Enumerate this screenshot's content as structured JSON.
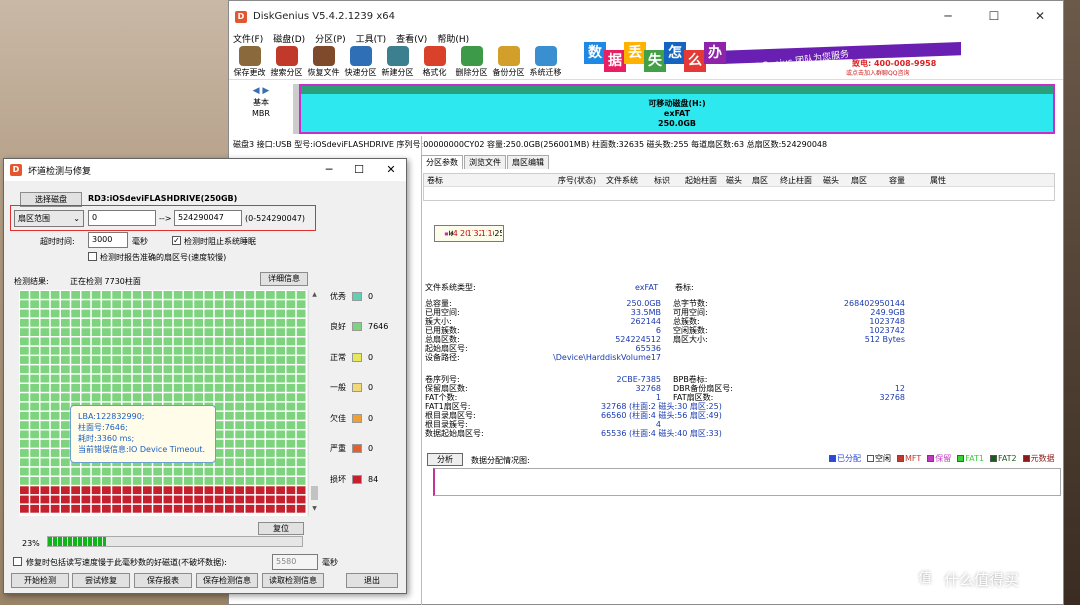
{
  "main": {
    "title": "DiskGenius V5.4.2.1239 x64",
    "logo": "D",
    "menu": [
      "文件(F)",
      "磁盘(D)",
      "分区(P)",
      "工具(T)",
      "查看(V)",
      "帮助(H)"
    ],
    "toolbar": [
      {
        "label": "保存更改",
        "color": "#8a6a3c",
        "icon": "save-changes-icon"
      },
      {
        "label": "搜索分区",
        "color": "#c0392b",
        "icon": "search-partition-icon"
      },
      {
        "label": "恢复文件",
        "color": "#7e4a2b",
        "icon": "recover-file-icon"
      },
      {
        "label": "快速分区",
        "color": "#2e6fb5",
        "icon": "quick-partition-icon"
      },
      {
        "label": "新建分区",
        "color": "#3c7f8e",
        "icon": "new-partition-icon"
      },
      {
        "label": "格式化",
        "color": "#d9412a",
        "icon": "format-icon"
      },
      {
        "label": "删除分区",
        "color": "#3c9a49",
        "icon": "delete-partition-icon"
      },
      {
        "label": "备份分区",
        "color": "#d2a02a",
        "icon": "backup-partition-icon"
      },
      {
        "label": "系统迁移",
        "color": "#3a8fd0",
        "icon": "system-migration-icon"
      }
    ],
    "banner": {
      "chars": [
        {
          "c": "数",
          "color": "#1e88e5"
        },
        {
          "c": "据",
          "color": "#e91e63"
        },
        {
          "c": "丢",
          "color": "#ffb300"
        },
        {
          "c": "失",
          "color": "#43a047"
        },
        {
          "c": "怎",
          "color": "#1565c0"
        },
        {
          "c": "么",
          "color": "#e53935"
        },
        {
          "c": "办",
          "color": "#8e24aa"
        }
      ],
      "slogan": "DiskGenius 团队为您服务",
      "phone": "致电: 400-008-9958",
      "qq": "或点击加入群聊QQ咨询"
    },
    "disk_map": {
      "basic": "基本",
      "mbr": "MBR",
      "partition_name": "可移动磁盘(H:)",
      "fs": "exFAT",
      "size": "250.0GB"
    },
    "disk_info": "磁盘3 接口:USB  型号:iOSdeviFLASHDRIVE  序列号:00000000CY02  容量:250.0GB(256001MB)  柱面数:32635  磁头数:255  每道扇区数:63  总扇区数:524290048",
    "tabs": [
      "分区参数",
      "浏览文件",
      "扇区编辑"
    ],
    "partition_table": {
      "headers": [
        "卷标",
        "序号(状态)",
        "文件系统",
        "标识",
        "起始柱面",
        "磁头",
        "扇区",
        "终止柱面",
        "磁头",
        "扇区",
        "容量",
        "属性"
      ],
      "row": [
        "可移动磁盘(H:)",
        "0",
        "exFAT",
        "07",
        "4",
        "20",
        "17",
        "32635",
        "139",
        "16",
        "250.0GB",
        ""
      ]
    },
    "fs_info": {
      "fs_type_label": "文件系统类型:",
      "fs_type": "exFAT",
      "volume_label_label": "卷标:",
      "left": [
        [
          "总容量:",
          "250.0GB"
        ],
        [
          "已用空间:",
          "33.5MB"
        ],
        [
          "簇大小:",
          "262144"
        ],
        [
          "已用簇数:",
          "6"
        ],
        [
          "总扇区数:",
          "524224512"
        ],
        [
          "起始扇区号:",
          "65536"
        ],
        [
          "设备路径:",
          "\\Device\\HarddiskVolume17"
        ]
      ],
      "right": [
        [
          "总字节数:",
          "268402950144"
        ],
        [
          "可用空间:",
          "249.9GB"
        ],
        [
          "总簇数:",
          "1023748"
        ],
        [
          "空闲簇数:",
          "1023742"
        ],
        [
          "扇区大小:",
          "512 Bytes"
        ]
      ],
      "left2": [
        [
          "卷序列号:",
          "2CBE-7385"
        ],
        [
          "保留扇区数:",
          "32768"
        ],
        [
          "FAT个数:",
          "1"
        ],
        [
          "FAT1扇区号:",
          "32768 (柱面:2 磁头:30 扇区:25)"
        ],
        [
          "根目录扇区号:",
          "66560 (柱面:4 磁头:56 扇区:49)"
        ],
        [
          "根目录簇号:",
          "4"
        ],
        [
          "数据起始扇区号:",
          "65536 (柱面:4 磁头:40 扇区:33)"
        ]
      ],
      "right2": [
        [
          "BPB卷标:",
          ""
        ],
        [
          "DBR备份扇区号:",
          "12"
        ],
        [
          "FAT扇区数:",
          "32768"
        ]
      ]
    },
    "analyze_button": "分析",
    "dist_label": "数据分配情况图:",
    "legend": [
      {
        "label": "已分配",
        "color": "#2b49d8"
      },
      {
        "label": "空闲",
        "color": "#ffffff"
      },
      {
        "label": "MFT",
        "color": "#c0392b"
      },
      {
        "label": "保留",
        "color": "#c03ac0"
      },
      {
        "label": "FAT1",
        "color": "#39d039"
      },
      {
        "label": "FAT2",
        "color": "#1a5a1a"
      },
      {
        "label": "元数据",
        "color": "#8b1a1a"
      }
    ]
  },
  "dialog": {
    "title": "坏道检测与修复",
    "select_disk_button": "选择磁盘",
    "disk_name": "RD3:iOSdeviFLASHDRIVE(250GB)",
    "range_select": "扇区范围",
    "range_start": "0",
    "arrow": "-->",
    "range_end": "524290047",
    "range_hint": "(0-524290047)",
    "timeout_label": "超时时间:",
    "timeout_value": "3000",
    "timeout_unit": "毫秒",
    "prevent_sleep_label": "检测时阻止系统睡眠",
    "report_exact_label": "检测时报告准确的扇区号(速度较慢)",
    "result_label": "检测结果:",
    "status": "正在检测 7730柱面",
    "detail_button": "详细信息",
    "categories": [
      {
        "label": "优秀",
        "count": "0",
        "color": "#5fd0b4"
      },
      {
        "label": "良好",
        "count": "7646",
        "color": "#7ed37e"
      },
      {
        "label": "正常",
        "count": "0",
        "color": "#e6e85a"
      },
      {
        "label": "一般",
        "count": "0",
        "color": "#f1d97a"
      },
      {
        "label": "欠佳",
        "count": "0",
        "color": "#f0a030"
      },
      {
        "label": "严重",
        "count": "0",
        "color": "#e06030"
      },
      {
        "label": "损坏",
        "count": "84",
        "color": "#c4202e"
      }
    ],
    "tooltip": {
      "lba": "LBA:122832990;",
      "cyl": "柱面号:7646;",
      "time": "耗时:3360 ms;",
      "error": "当前错误信息:IO Device Timeout."
    },
    "reset_button": "复位",
    "progress": 23,
    "progress_text": "23%",
    "repair_slow_label": "修复时包括读写速度慢于此毫秒数的好磁道(不破坏数据):",
    "repair_ms": "5580",
    "repair_unit": "毫秒",
    "buttons": [
      "开始检测",
      "尝试修复",
      "保存报表",
      "保存检测信息",
      "读取检测信息",
      "退出"
    ]
  },
  "brand": "什么值得买"
}
